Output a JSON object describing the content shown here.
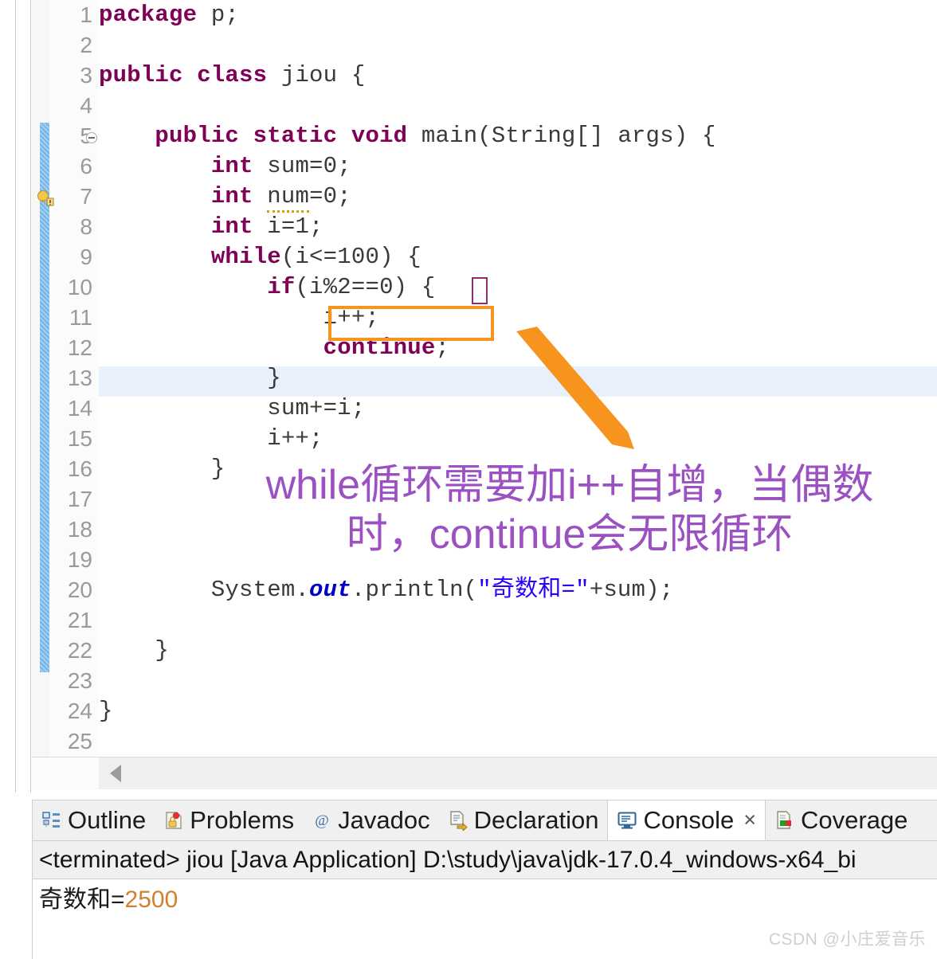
{
  "editor": {
    "first_visible_line": 1,
    "last_visible_line": 25,
    "highlighted_line": 13,
    "fold_marker_line": 5,
    "warning_marker_line": 7,
    "lines": [
      {
        "n": "1",
        "indent": 0,
        "html_key": "l1"
      },
      {
        "n": "2",
        "indent": 0,
        "html_key": "l2"
      },
      {
        "n": "3",
        "indent": 0,
        "html_key": "l3"
      },
      {
        "n": "4",
        "indent": 0,
        "html_key": "l4"
      },
      {
        "n": "5",
        "indent": 0,
        "html_key": "l5"
      },
      {
        "n": "6",
        "indent": 0,
        "html_key": "l6"
      },
      {
        "n": "7",
        "indent": 0,
        "html_key": "l7"
      },
      {
        "n": "8",
        "indent": 0,
        "html_key": "l8"
      },
      {
        "n": "9",
        "indent": 0,
        "html_key": "l9"
      },
      {
        "n": "10",
        "indent": 0,
        "html_key": "l10"
      },
      {
        "n": "11",
        "indent": 0,
        "html_key": "l11"
      },
      {
        "n": "12",
        "indent": 0,
        "html_key": "l12"
      },
      {
        "n": "13",
        "indent": 0,
        "html_key": "l13"
      },
      {
        "n": "14",
        "indent": 0,
        "html_key": "l14"
      },
      {
        "n": "15",
        "indent": 0,
        "html_key": "l15"
      },
      {
        "n": "16",
        "indent": 0,
        "html_key": "l16"
      },
      {
        "n": "17",
        "indent": 0,
        "html_key": "l17"
      },
      {
        "n": "18",
        "indent": 0,
        "html_key": "l18"
      },
      {
        "n": "19",
        "indent": 0,
        "html_key": "l19"
      },
      {
        "n": "20",
        "indent": 0,
        "html_key": "l20"
      },
      {
        "n": "21",
        "indent": 0,
        "html_key": "l21"
      },
      {
        "n": "22",
        "indent": 0,
        "html_key": "l22"
      },
      {
        "n": "23",
        "indent": 0,
        "html_key": "l23"
      },
      {
        "n": "24",
        "indent": 0,
        "html_key": "l24"
      },
      {
        "n": "25",
        "indent": 0,
        "html_key": "l25"
      }
    ],
    "code_text": {
      "l1": "package p;",
      "l2": "",
      "l3": "public class jiou {",
      "l4": "",
      "l5": "    public static void main(String[] args) {",
      "l6": "        int sum=0;",
      "l7": "        int num=0;",
      "l8": "        int i=1;",
      "l9": "        while(i<=100) {",
      "l10": "            if(i%2==0) {",
      "l11": "                i++;",
      "l12": "                continue;",
      "l13": "            }",
      "l14": "            sum+=i;",
      "l15": "            i++;",
      "l16": "        }",
      "l17": "",
      "l18": "",
      "l19": "",
      "l20": "        System.out.println(\"奇数和=\"+sum);",
      "l21": "",
      "l22": "    }",
      "l23": "",
      "l24": "}",
      "l25": ""
    }
  },
  "annotation": {
    "line1": "while循环需要加i++自增，当偶数",
    "line2": "时，continue会无限循环",
    "color": "#9b51c2",
    "arrow_color": "#f7941e",
    "highlight_box_color": "#f7941e",
    "bracket_box_color": "#8b2f6e"
  },
  "bottom_panel": {
    "tabs": [
      {
        "label": "Outline",
        "icon": "outline-icon",
        "active": false,
        "closable": false
      },
      {
        "label": "Problems",
        "icon": "problems-icon",
        "active": false,
        "closable": false
      },
      {
        "label": "Javadoc",
        "icon": "javadoc-icon",
        "active": false,
        "closable": false
      },
      {
        "label": "Declaration",
        "icon": "declaration-icon",
        "active": false,
        "closable": false
      },
      {
        "label": "Console",
        "icon": "console-icon",
        "active": true,
        "closable": true
      },
      {
        "label": "Coverage",
        "icon": "coverage-icon",
        "active": false,
        "closable": false
      }
    ],
    "close_glyph": "×",
    "launch_line": "<terminated> jiou [Java Application] D:\\study\\java\\jdk-17.0.4_windows-x64_bi",
    "console_output_label": "奇数和=",
    "console_output_value": "2500"
  },
  "watermark": {
    "text": "CSDN @小庄爱音乐"
  }
}
